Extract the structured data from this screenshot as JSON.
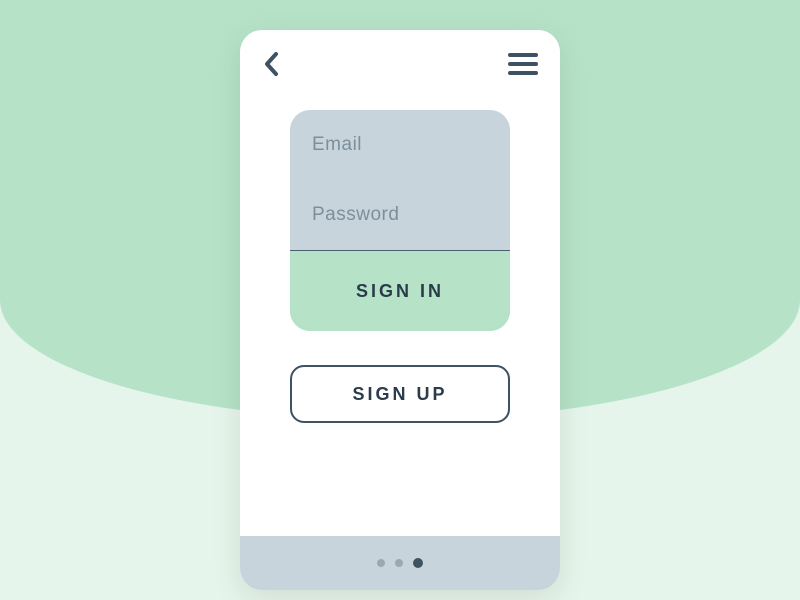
{
  "auth": {
    "email_placeholder": "Email",
    "password_placeholder": "Password",
    "signin_label": "SIGN IN",
    "signup_label": "SIGN UP"
  },
  "pagination": {
    "total": 3,
    "active_index": 2
  },
  "colors": {
    "accent_mint": "#b6e3c8",
    "background_light": "#e6f5eb",
    "card_grey": "#c8d4dc",
    "text_dark": "#3e5264"
  }
}
